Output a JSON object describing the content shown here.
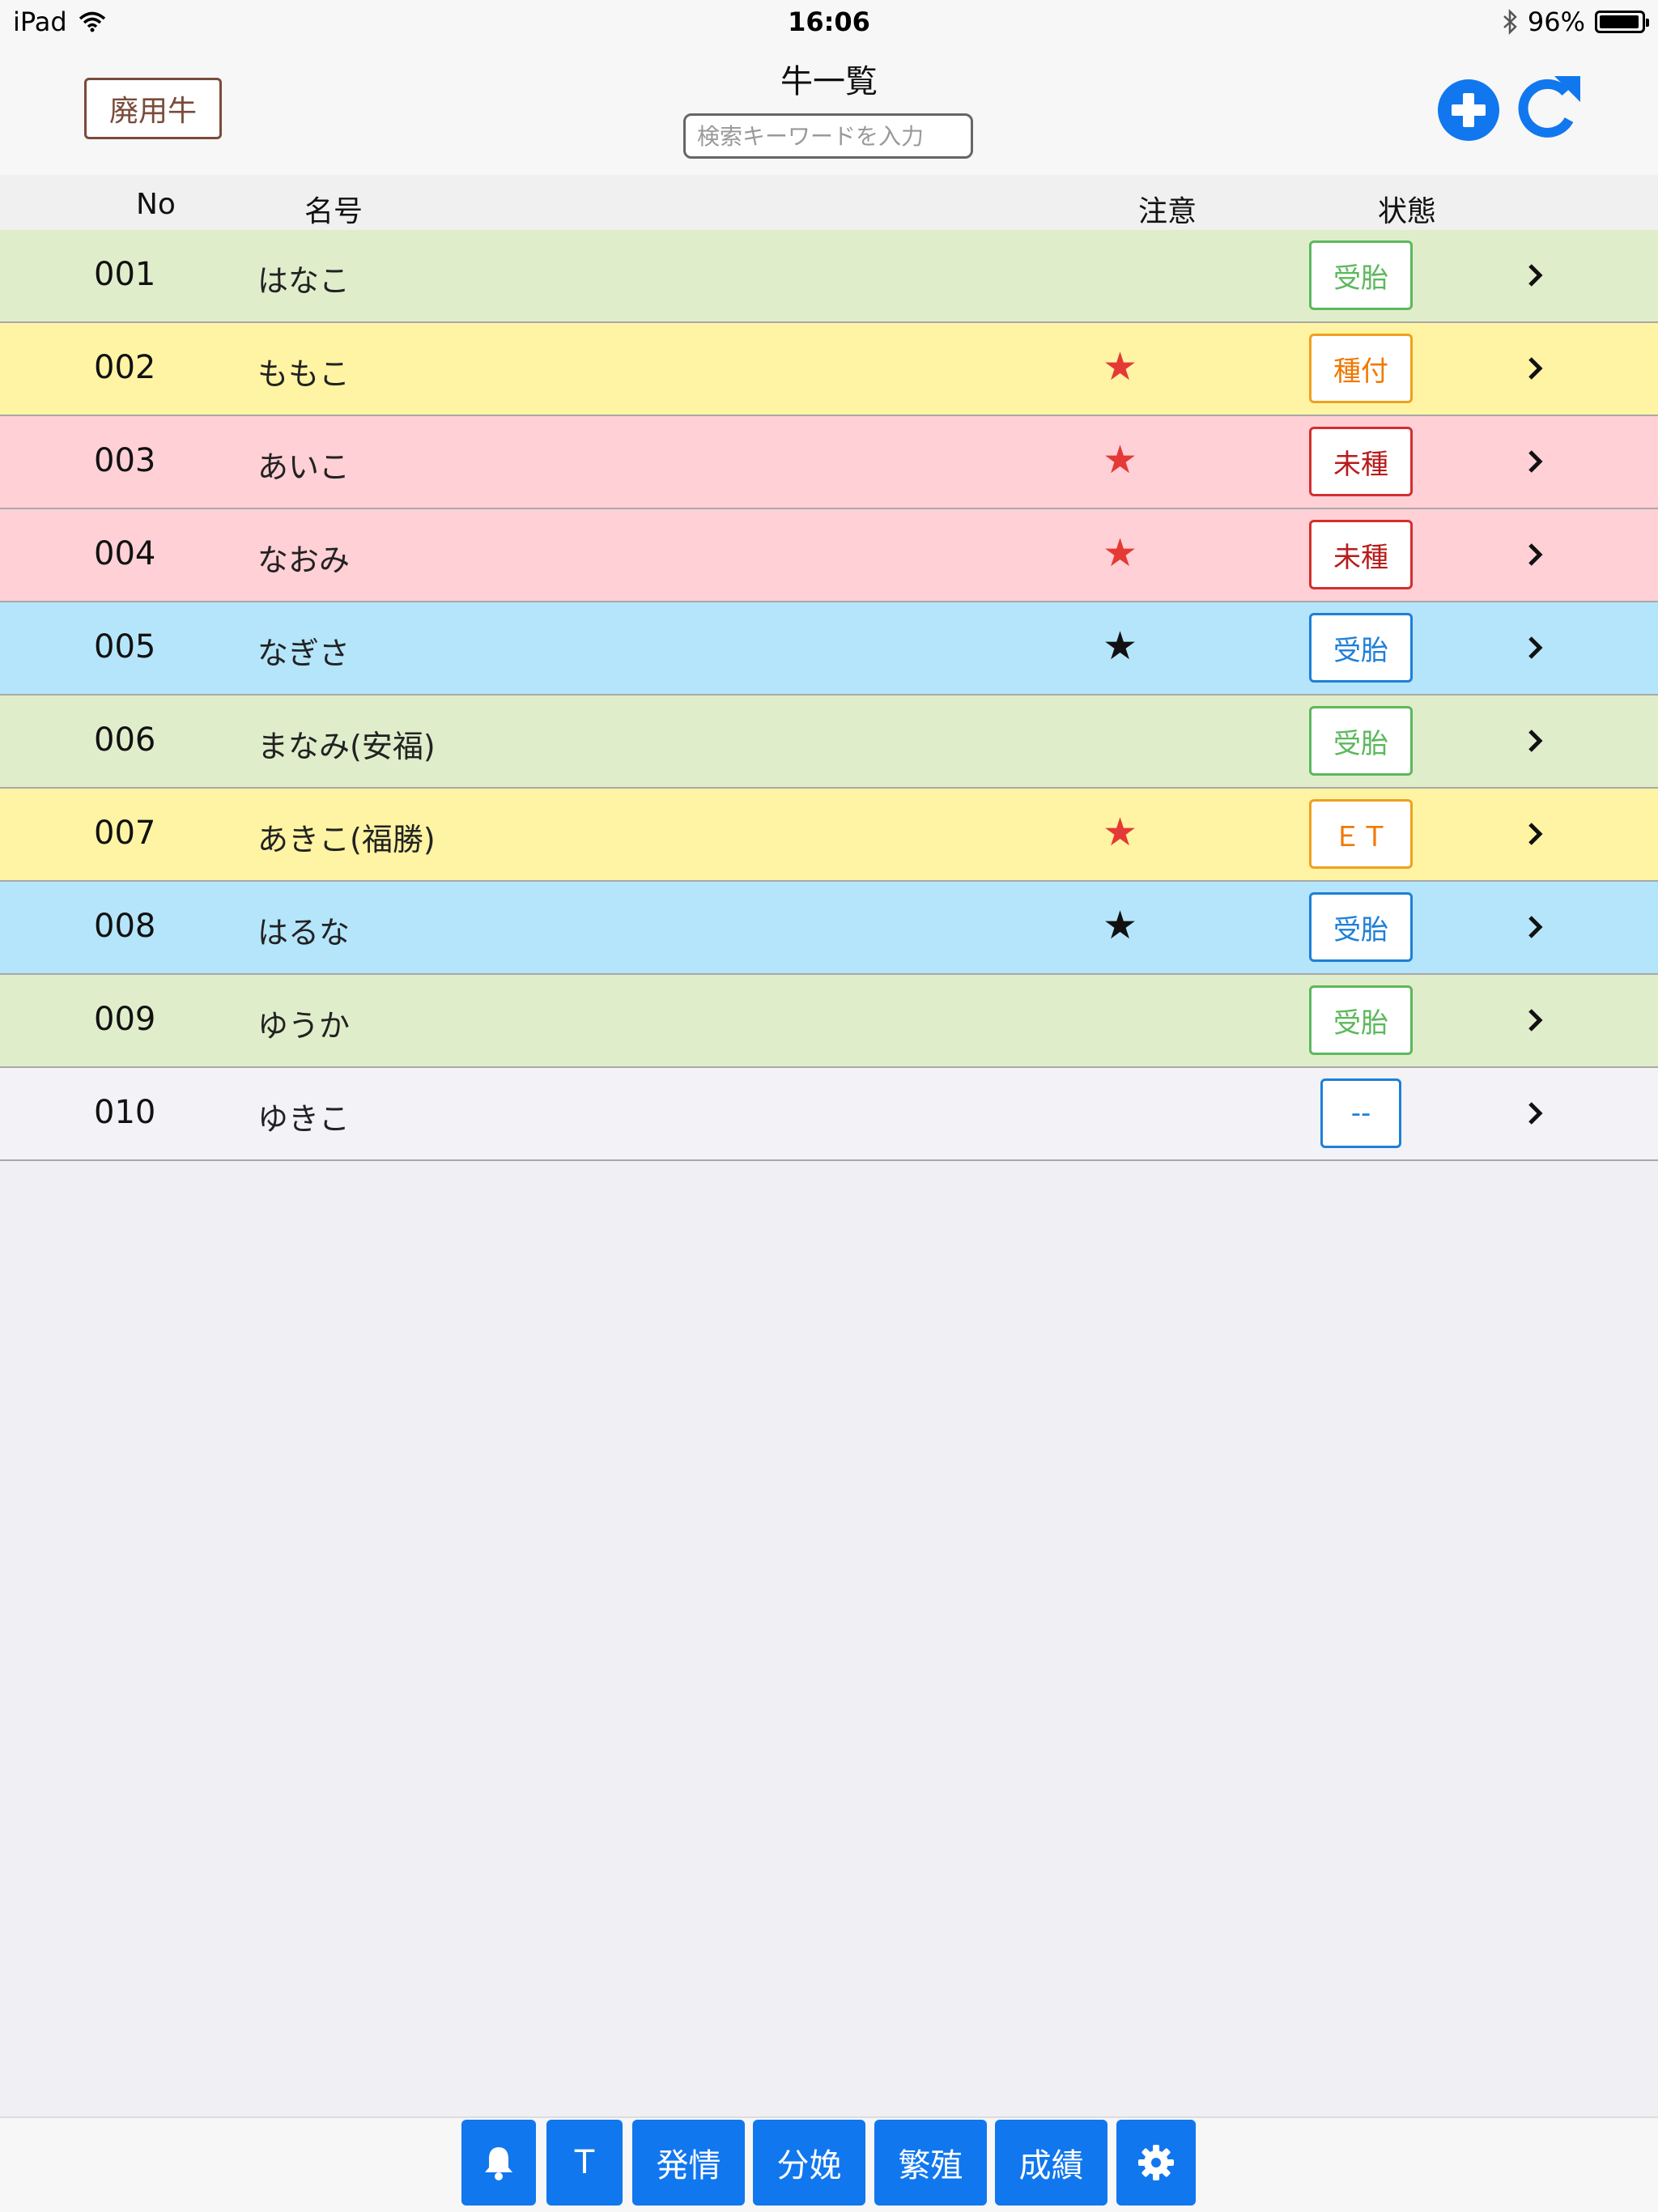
{
  "status_bar": {
    "device": "iPad",
    "time": "16:06",
    "battery": "96%",
    "battery_level": 0.96
  },
  "header": {
    "title": "牛一覧",
    "retired_button": "廃用牛",
    "search_placeholder": "検索キーワードを入力",
    "add_icon": "plus-circle-icon",
    "refresh_icon": "refresh-icon",
    "accent_color": "#1177ee"
  },
  "table": {
    "columns": {
      "no": "No",
      "name": "名号",
      "caution": "注意",
      "status": "状態"
    },
    "rows": [
      {
        "no": "001",
        "name": "はなこ",
        "star": "",
        "status": "受胎",
        "row_color": "green",
        "badge_color": "green"
      },
      {
        "no": "002",
        "name": "ももこ",
        "star": "★",
        "star_color": "red",
        "status": "種付",
        "row_color": "yellow",
        "badge_color": "orange"
      },
      {
        "no": "003",
        "name": "あいこ",
        "star": "★",
        "star_color": "red",
        "status": "未種",
        "row_color": "pink",
        "badge_color": "red"
      },
      {
        "no": "004",
        "name": "なおみ",
        "star": "★",
        "star_color": "red",
        "status": "未種",
        "row_color": "pink",
        "badge_color": "red"
      },
      {
        "no": "005",
        "name": "なぎさ",
        "star": "★",
        "star_color": "black",
        "status": "受胎",
        "row_color": "blue",
        "badge_color": "blue"
      },
      {
        "no": "006",
        "name": "まなみ(安福)",
        "star": "",
        "status": "受胎",
        "row_color": "green",
        "badge_color": "green"
      },
      {
        "no": "007",
        "name": "あきこ(福勝)",
        "star": "★",
        "star_color": "red",
        "status": "ＥＴ",
        "row_color": "yellow",
        "badge_color": "orange"
      },
      {
        "no": "008",
        "name": "はるな",
        "star": "★",
        "star_color": "black",
        "status": "受胎",
        "row_color": "blue",
        "badge_color": "blue"
      },
      {
        "no": "009",
        "name": "ゆうか",
        "star": "",
        "status": "受胎",
        "row_color": "green",
        "badge_color": "green"
      },
      {
        "no": "010",
        "name": "ゆきこ",
        "star": "",
        "status": "--",
        "row_color": "white",
        "badge_color": "blue"
      }
    ]
  },
  "toolbar": {
    "bell_icon": "bell-icon",
    "t_label": "T",
    "estrus_label": "発情",
    "calving_label": "分娩",
    "breeding_label": "繁殖",
    "results_label": "成績",
    "settings_icon": "gear-icon"
  }
}
